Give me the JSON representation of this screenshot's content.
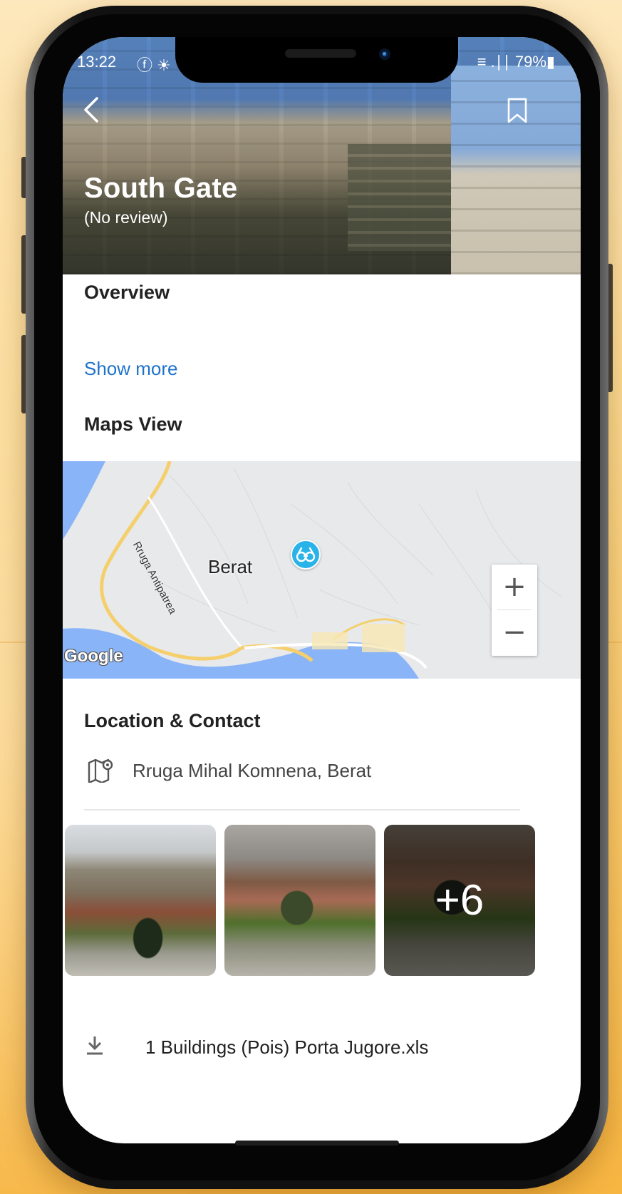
{
  "status_bar": {
    "time": "13:22",
    "left_icons": "ⓕ ☀",
    "right_status": "≡ .∣∣ 79%▮"
  },
  "header": {
    "title": "South Gate",
    "review": "(No review)",
    "back_icon": "chevron-left-icon",
    "bookmark_icon": "bookmark-icon"
  },
  "overview": {
    "title": "Overview",
    "show_more": "Show more"
  },
  "map": {
    "title": "Maps View",
    "city_label": "Berat",
    "road_label": "Rruga Antipatrea",
    "provider": "Google",
    "zoom_in": "+",
    "zoom_out": "−",
    "pin_icon": "binoculars-icon"
  },
  "location": {
    "title": "Location & Contact",
    "address": "Rruga Mihal Komnena, Berat",
    "address_icon": "map-pin-icon"
  },
  "gallery": {
    "more_count": "+6"
  },
  "download": {
    "file_name": "1 Buildings (Pois) Porta Jugore.xls",
    "icon": "download-icon"
  },
  "colors": {
    "accent_link": "#1f73c9",
    "map_water": "#8ab4f8",
    "map_road": "#f5cf6b",
    "pin": "#29b3e8"
  }
}
